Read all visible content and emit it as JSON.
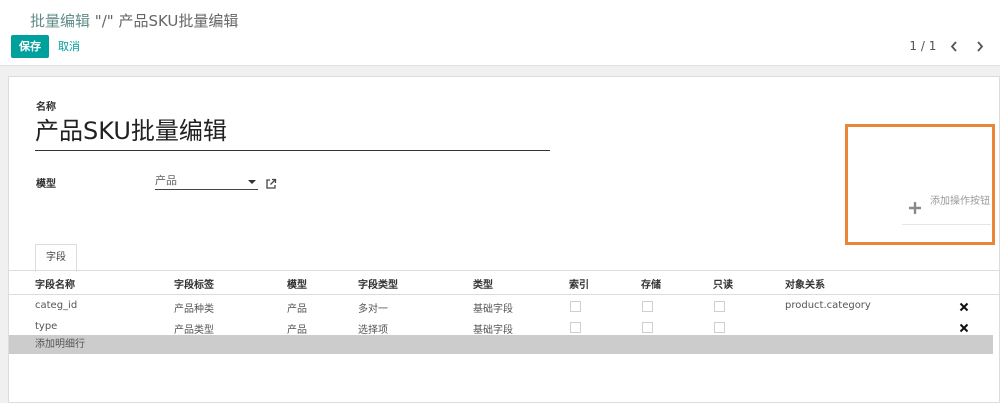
{
  "breadcrumb": {
    "parent": "批量编辑",
    "separator": "\"/\"",
    "current": "产品SKU批量编辑"
  },
  "toolbar": {
    "save_label": "保存",
    "discard_label": "取消"
  },
  "pager": {
    "value": "1 / 1",
    "prev_icon": "chevron-left-icon",
    "next_icon": "chevron-right-icon"
  },
  "form": {
    "name_label": "名称",
    "name_value": "产品SKU批量编辑",
    "model_label": "模型",
    "model_value": "产品",
    "add_action_label": "添加操作按钮"
  },
  "tabs": [
    {
      "label": "字段"
    }
  ],
  "fields_table": {
    "columns": [
      "字段名称",
      "字段标签",
      "模型",
      "字段类型",
      "类型",
      "索引",
      "存储",
      "只读",
      "对象关系"
    ],
    "rows": [
      {
        "name": "categ_id",
        "label": "产品种类",
        "model": "产品",
        "field_type": "多对一",
        "type": "基础字段",
        "index": false,
        "stored": false,
        "readonly": false,
        "relation": "product.category"
      },
      {
        "name": "type",
        "label": "产品类型",
        "model": "产品",
        "field_type": "选择项",
        "type": "基础字段",
        "index": false,
        "stored": false,
        "readonly": false,
        "relation": ""
      }
    ],
    "add_line_label": "添加明细行"
  },
  "colors": {
    "primary": "#00a09d",
    "highlight": "#e8873a",
    "add_line_bg": "#cccccc"
  }
}
